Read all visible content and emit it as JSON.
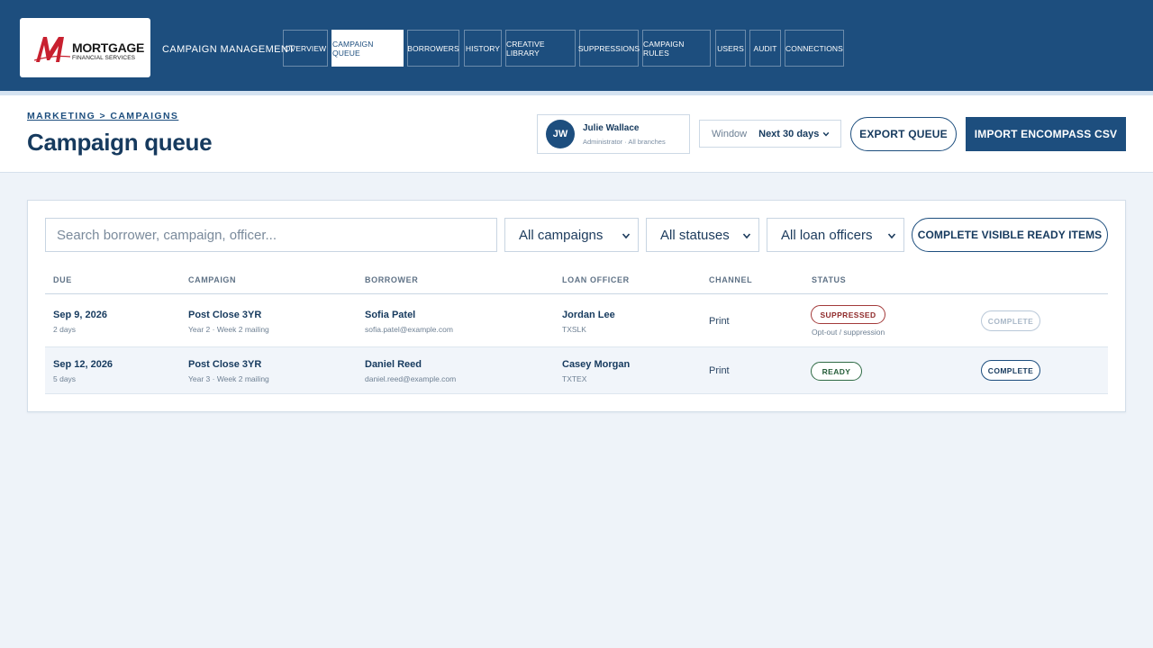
{
  "brand": {
    "logo_word": "MORTGAGE",
    "logo_sub": "FINANCIAL SERVICES",
    "app_title": "CAMPAIGN MANAGEMENT",
    "accent": "#1d4e7e",
    "logo_red": "#c8202f"
  },
  "nav": [
    {
      "label": "OVERVIEW"
    },
    {
      "label": "CAMPAIGN QUEUE"
    },
    {
      "label": "BORROWERS"
    },
    {
      "label": "HISTORY"
    },
    {
      "label": "CREATIVE LIBRARY"
    },
    {
      "label": "SUPPRESSIONS"
    },
    {
      "label": "CAMPAIGN RULES"
    },
    {
      "label": "USERS"
    },
    {
      "label": "AUDIT"
    },
    {
      "label": "CONNECTIONS"
    }
  ],
  "header": {
    "breadcrumb": "MARKETING > CAMPAIGNS",
    "title": "Campaign queue",
    "user": {
      "initials": "JW",
      "name": "Julie Wallace",
      "role": "Administrator · All branches"
    },
    "window": {
      "label": "Window",
      "value": "Next 30 days"
    },
    "export_label": "EXPORT QUEUE",
    "import_label": "IMPORT ENCOMPASS CSV"
  },
  "filters": {
    "search_placeholder": "Search borrower, campaign, officer...",
    "campaigns": "All campaigns",
    "statuses": "All statuses",
    "officers": "All loan officers",
    "complete_ready_label": "COMPLETE VISIBLE READY ITEMS"
  },
  "table": {
    "columns": {
      "due": "DUE",
      "campaign": "CAMPAIGN",
      "borrower": "BORROWER",
      "officer": "LOAN OFFICER",
      "channel": "CHANNEL",
      "status": "STATUS"
    },
    "rows": [
      {
        "due": "Sep 9, 2026",
        "due_sub": "2 days",
        "campaign": "Post Close 3YR",
        "campaign_sub": "Year 2 · Week 2 mailing",
        "borrower": "Sofia Patel",
        "borrower_email": "sofia.patel@example.com",
        "officer": "Jordan Lee",
        "officer_code": "TXSLK",
        "channel": "Print",
        "status": "SUPPRESSED",
        "status_note": "Opt-out / suppression",
        "action": "COMPLETE"
      },
      {
        "due": "Sep 12, 2026",
        "due_sub": "5 days",
        "campaign": "Post Close 3YR",
        "campaign_sub": "Year 3 · Week 2 mailing",
        "borrower": "Daniel Reed",
        "borrower_email": "daniel.reed@example.com",
        "officer": "Casey Morgan",
        "officer_code": "TXTEX",
        "channel": "Print",
        "status": "READY",
        "status_note": "",
        "action": "COMPLETE"
      }
    ]
  }
}
